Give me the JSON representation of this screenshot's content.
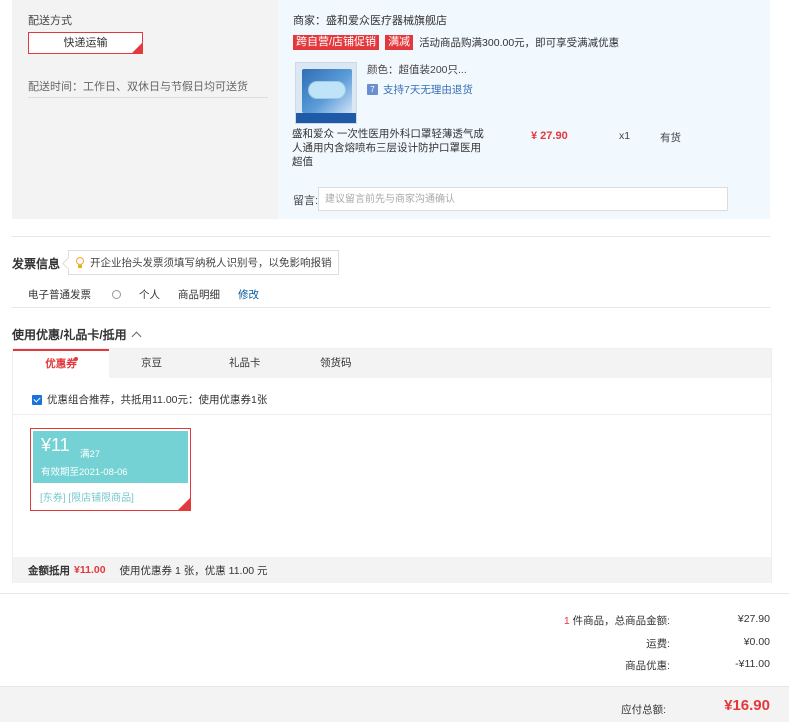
{
  "shipping": {
    "title": "配送方式",
    "option_label": "快递运输",
    "time_text": "配送时间：工作日、双休日与节假日均可送货"
  },
  "order": {
    "merchant": "商家：盛和爱众医疗器械旗舰店",
    "promo_tags": [
      "跨自营/店铺促销",
      "满减"
    ],
    "promo_text": "活动商品购满300.00元，即可享受满减优惠",
    "product": {
      "color": "颜色：超值装200只...",
      "return_policy": "支持7天无理由退货",
      "name": "盛和爱众 一次性医用外科口罩轻薄透气成人通用内含熔喷布三层设计防护口罩医用 超值",
      "price": "¥ 27.90",
      "qty": "x1",
      "stock": "有货"
    },
    "remark_label": "留言:",
    "remark_placeholder": "建议留言前先与商家沟通确认"
  },
  "invoice": {
    "title": "发票信息",
    "tip": "开企业抬头发票须填写纳税人识别号，以免影响报销",
    "type": "电子普通发票",
    "holder": "个人",
    "content": "商品明细",
    "edit_label": "修改"
  },
  "coupons": {
    "title": "使用优惠/礼品卡/抵用",
    "tabs": [
      {
        "label": "优惠券"
      },
      {
        "label": "京豆"
      },
      {
        "label": "礼品卡"
      },
      {
        "label": "领货码"
      }
    ],
    "combo_text": "优惠组合推荐，共抵用11.00元：使用优惠券1张",
    "coupon": {
      "amount": "¥11",
      "condition": "满27",
      "expiry": "有效期至2021-08-06",
      "tags": "[东券]  [限店铺限商品]"
    },
    "footer_label": "金额抵用",
    "footer_amount": "¥11.00",
    "footer_text": "使用优惠券 1 张，优惠 11.00 元"
  },
  "summary": {
    "count": "1",
    "count_label": " 件商品，总商品金额:",
    "goods_total": "¥27.90",
    "freight_label": "运费:",
    "freight": "¥0.00",
    "discount_label": "商品优惠:",
    "discount": "-¥11.00",
    "payable_label": "应付总额:",
    "payable": "¥16.90"
  },
  "colors": {
    "accent": "#e4393c",
    "coupon": "#74d2d4",
    "link": "#005aa0"
  }
}
